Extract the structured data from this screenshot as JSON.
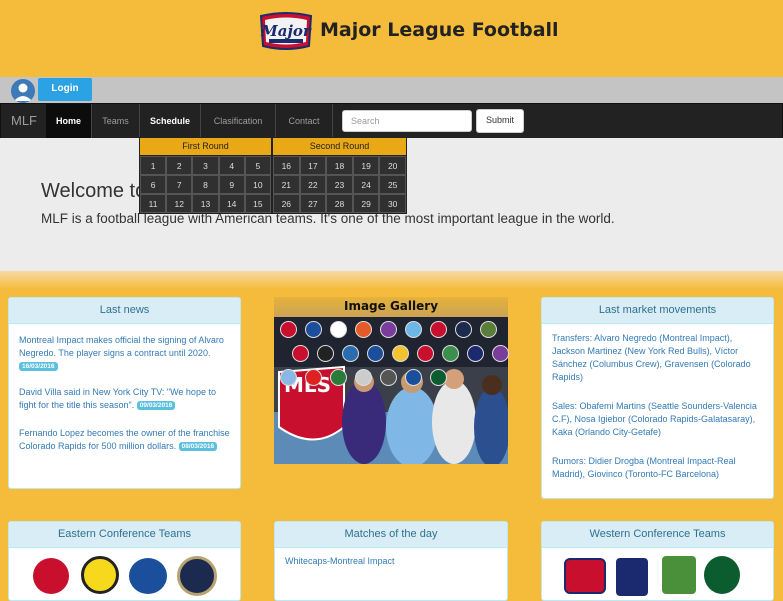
{
  "header": {
    "title": "Major League Football",
    "logo_text": "Major League"
  },
  "auth": {
    "login_label": "Login"
  },
  "nav": {
    "brand": "MLF",
    "items": [
      {
        "label": "Home"
      },
      {
        "label": "Teams"
      },
      {
        "label": "Schedule"
      },
      {
        "label": "Clasification"
      },
      {
        "label": "Contact"
      }
    ],
    "search_placeholder": "Search",
    "submit_label": "Submit"
  },
  "schedule_dropdown": {
    "rounds": [
      {
        "title": "First Round",
        "days": [
          "1",
          "2",
          "3",
          "4",
          "5",
          "6",
          "7",
          "8",
          "9",
          "10",
          "11",
          "12",
          "13",
          "14",
          "15"
        ]
      },
      {
        "title": "Second Round",
        "days": [
          "16",
          "17",
          "18",
          "19",
          "20",
          "21",
          "22",
          "23",
          "24",
          "25",
          "26",
          "27",
          "28",
          "29",
          "30"
        ]
      }
    ]
  },
  "jumbotron": {
    "heading": "Welcome to the League webpage",
    "text": "MLF is a football league with American teams. It's one of the most important league in the world."
  },
  "last_news": {
    "title": "Last news",
    "items": [
      {
        "text": "Montreal Impact makes official the signing of Alvaro Negredo. The player signs a contract until 2020.",
        "date": "16/03/2016"
      },
      {
        "text": "David Villa said in New York City TV: \"We hope to fight for the title this season\".",
        "date": "09/03/2016"
      },
      {
        "text": "Fernando Lopez becomes the owner of the franchise Colorado Rapids for 500 million dollars.",
        "date": "08/03/2016"
      }
    ]
  },
  "gallery": {
    "title": "Image Gallery",
    "banner_text": "MLS"
  },
  "market": {
    "title": "Last market movements",
    "items": [
      "Transfers: Alvaro Negredo (Montreal Impact), Jackson Martinez (New York Red Bulls), Víctor Sánchez (Columbus Crew), Gravensen (Colorado Rapids)",
      "Sales: Obafemi Martins (Seattle Sounders-Valencia C.F), Nosa Igiebor (Colorado Rapids-Galatasaray), Kaka (Orlando City-Getafe)",
      "Rumors: Didier Drogba (Montreal Impact-Real Madrid), Giovinco (Toronto-FC Barcelona)"
    ]
  },
  "eastern": {
    "title": "Eastern Conference Teams"
  },
  "matches": {
    "title": "Matches of the day",
    "items": [
      "Whitecaps-Montreal Impact"
    ]
  },
  "western": {
    "title": "Western Conference Teams"
  },
  "colors": {
    "accent": "#f5bc3c",
    "navbar": "#222222",
    "panel_header": "#d9edf7",
    "link": "#337ab7",
    "badge": "#5bc0de"
  }
}
